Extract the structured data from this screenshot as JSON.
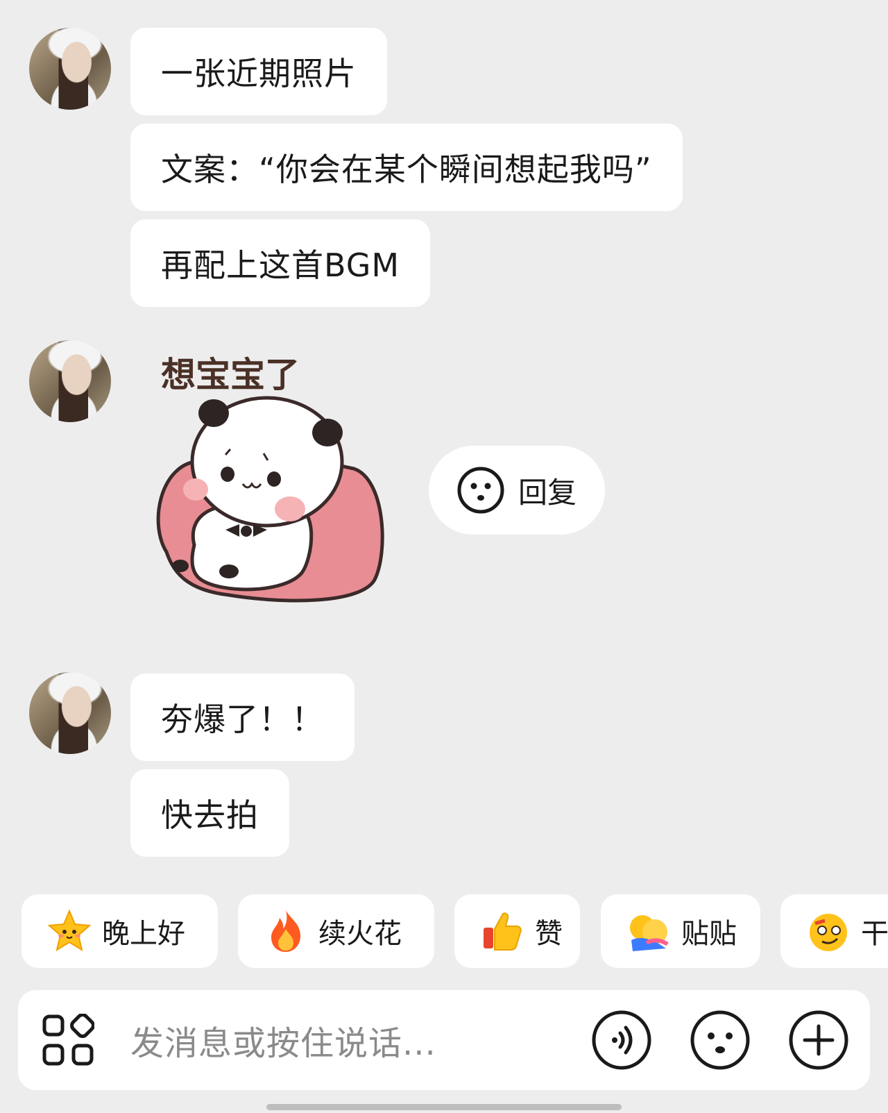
{
  "messages": [
    {
      "text": "一张近期照片"
    },
    {
      "text": "文案：“你会在某个瞬间想起我吗”"
    },
    {
      "text": "再配上这首BGM"
    },
    {
      "sticker_caption": "想宝宝了"
    },
    {
      "text": "夯爆了！！"
    },
    {
      "text": "快去拍"
    }
  ],
  "reply_button": {
    "label": "回复",
    "icon": "smiley-face-icon"
  },
  "quick_replies": [
    {
      "label": "晚上好",
      "icon": "star-icon"
    },
    {
      "label": "续火花",
      "icon": "fire-icon"
    },
    {
      "label": "赞",
      "icon": "thumbs-up-icon"
    },
    {
      "label": "贴贴",
      "icon": "hug-icon"
    },
    {
      "label": "干杯",
      "icon": "smirk-emoji-icon"
    }
  ],
  "input": {
    "placeholder": "发消息或按住说话..."
  },
  "toolbar": {
    "left_icon": "apps-grid-icon",
    "voice_icon": "voice-icon",
    "emoji_icon": "emoji-icon",
    "plus_icon": "plus-icon"
  }
}
